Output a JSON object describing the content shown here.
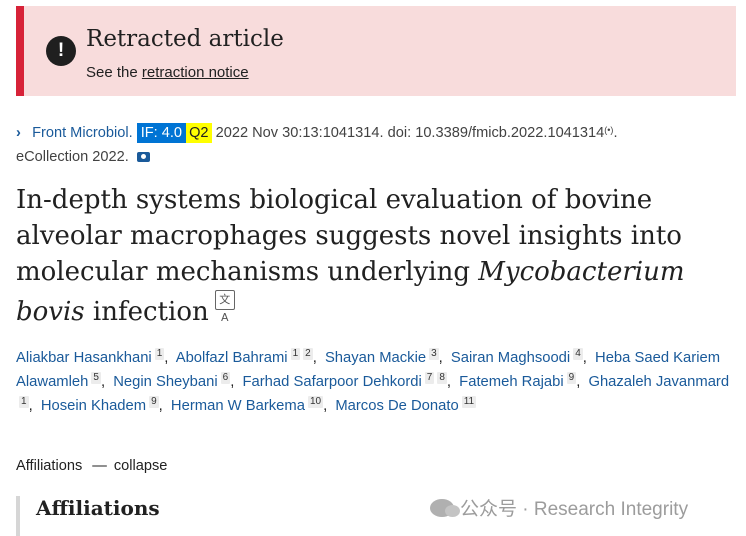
{
  "banner": {
    "icon": "exclamation-icon",
    "title": "Retracted article",
    "notice_prefix": "See the",
    "notice_link": "retraction notice"
  },
  "citation": {
    "chevron": "›",
    "journal": "Front Microbiol.",
    "impact_factor": "IF: 4.0",
    "quartile": "Q2",
    "details": "2022 Nov 30:13:1041314. doi: 10.3389/fmicb.2022.1041314",
    "wave_icon": "(•)",
    "trailing": ".",
    "ecollection": "eCollection 2022.",
    "camera_icon": "camera-icon"
  },
  "title": {
    "part1": "In-depth systems biological evaluation of bovine alveolar macrophages suggests novel insights into molecular mechanisms underlying",
    "species_genus": "Mycobacterium",
    "species_epithet": "bovis",
    "part2": "infection",
    "translate_icon": "文A"
  },
  "authors": [
    {
      "name": "Aliakbar Hasankhani",
      "affs": [
        "1"
      ],
      "sep": ","
    },
    {
      "name": "Abolfazl Bahrami",
      "affs": [
        "1",
        "2"
      ],
      "sep": ","
    },
    {
      "name": "Shayan Mackie",
      "affs": [
        "3"
      ],
      "sep": ","
    },
    {
      "name": "Sairan Maghsoodi",
      "affs": [
        "4"
      ],
      "sep": ","
    },
    {
      "name": "Heba Saed Kariem Alawamleh",
      "affs": [
        "5"
      ],
      "sep": ","
    },
    {
      "name": "Negin Sheybani",
      "affs": [
        "6"
      ],
      "sep": ","
    },
    {
      "name": "Farhad Safarpoor Dehkordi",
      "affs": [
        "7",
        "8"
      ],
      "sep": ","
    },
    {
      "name": "Fatemeh Rajabi",
      "affs": [
        "9"
      ],
      "sep": ","
    },
    {
      "name": "Ghazaleh Javanmard",
      "affs": [
        "1"
      ],
      "sep": ","
    },
    {
      "name": "Hosein Khadem",
      "affs": [
        "9"
      ],
      "sep": ","
    },
    {
      "name": "Herman W Barkema",
      "affs": [
        "10"
      ],
      "sep": ","
    },
    {
      "name": "Marcos De Donato",
      "affs": [
        "11"
      ],
      "sep": ""
    }
  ],
  "affiliations": {
    "toggle_label": "Affiliations",
    "toggle_dash": "—",
    "toggle_action": "collapse",
    "heading": "Affiliations"
  },
  "watermark": {
    "text": "公众号 · Research Integrity"
  }
}
